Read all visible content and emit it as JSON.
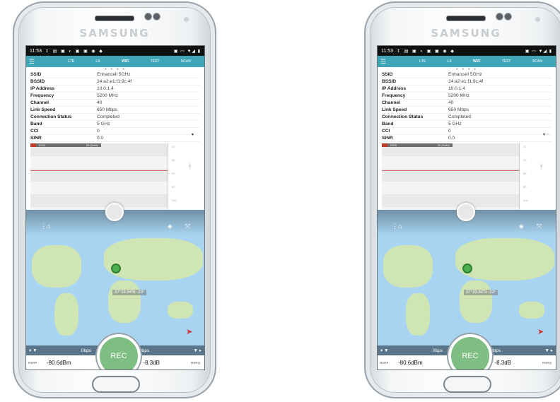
{
  "device": {
    "brand": "SAMSUNG"
  },
  "status_bar": {
    "time": "11:53",
    "icons": "↥ ▤ ▣ ◐ ▣ ▣ ◉ ◆",
    "right": "▣ ▭ ▼◢ ▮"
  },
  "tabs": [
    {
      "label": "LTE",
      "active": false
    },
    {
      "label": "LS",
      "active": false
    },
    {
      "label": "WIFI",
      "active": true
    },
    {
      "label": "TEST",
      "active": false
    },
    {
      "label": "SCAN",
      "active": false
    }
  ],
  "page_dots": "● ● ● ●",
  "info_rows": [
    {
      "key": "SSID",
      "value": "Enhancell 5GHz"
    },
    {
      "key": "BSSID",
      "value": "24:a2:e1:f1:9c:4f"
    },
    {
      "key": "IP Address",
      "value": "10.0.1.4"
    },
    {
      "key": "Frequency",
      "value": "5200 MHz"
    },
    {
      "key": "Channel",
      "value": "40"
    },
    {
      "key": "Link Speed",
      "value": "650 Mbps"
    },
    {
      "key": "Connection Status",
      "value": "Completed"
    },
    {
      "key": "Band",
      "value": "5 GHz"
    },
    {
      "key": "CCI",
      "value": "0"
    },
    {
      "key": "SINR",
      "value": "0.0"
    }
  ],
  "graph": {
    "legend_label": "RSSI",
    "legend_value": "55 (Kalle)",
    "ticks": [
      "20",
      "40",
      "60",
      "80",
      "100"
    ],
    "unit": "dBm",
    "line_color": "#d46a6a"
  },
  "map": {
    "location_label": "37°33.94'N -23°"
  },
  "bottom": {
    "download": "0bps",
    "upload": "0bps",
    "rsrp_label": "RSRP",
    "rsrp_value": "-80.6dBm",
    "rsrq_label": "RSRQ",
    "rsrq_value": "-8.3dB",
    "rec_label": "REC"
  },
  "colors": {
    "accent": "#3fa6b8",
    "rec": "#7fbe82",
    "map_water": "#a9d4f1"
  }
}
